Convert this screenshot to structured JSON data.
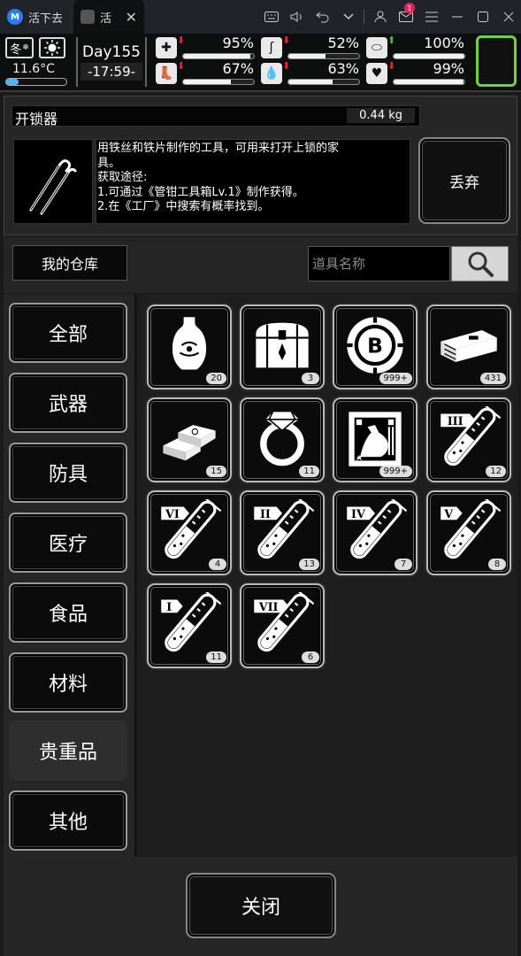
{
  "titlebar": {
    "tabs": [
      {
        "label": "活下去",
        "icon": "app-logo-icon"
      },
      {
        "label": "活",
        "icon": "game-thumb-icon"
      }
    ],
    "mail_badge": "1",
    "icons": [
      "keyboard-icon",
      "volume-icon",
      "undo-icon",
      "chevron-down-icon",
      "user-icon",
      "mail-icon",
      "menu-icon",
      "minimize-icon",
      "maximize-icon",
      "close-icon"
    ]
  },
  "hud": {
    "season": "冬",
    "temperature": "11.6°C",
    "temperature_level": 0.2,
    "day": "Day155",
    "time": "-17:59-",
    "stats": [
      {
        "name": "health",
        "icon": "health-kit-icon",
        "value": "95%",
        "level": 0.95,
        "trend": "down"
      },
      {
        "name": "hunger",
        "icon": "stomach-icon",
        "value": "52%",
        "level": 0.52,
        "trend": "down"
      },
      {
        "name": "medicine",
        "icon": "pill-icon",
        "value": "100%",
        "level": 1.0,
        "trend": "up"
      },
      {
        "name": "stamina",
        "icon": "foot-icon",
        "value": "67%",
        "level": 0.67,
        "trend": "down"
      },
      {
        "name": "thirst",
        "icon": "water-drop-icon",
        "value": "63%",
        "level": 0.63,
        "trend": "down"
      },
      {
        "name": "mood",
        "icon": "heart-icon",
        "value": "99%",
        "level": 0.99,
        "trend": "down"
      }
    ],
    "accent": "#6fd13c"
  },
  "detail": {
    "name": "开锁器",
    "weight": "0.44 kg",
    "description_lines": [
      "用铁丝和铁片制作的工具，可用来打开上锁的家",
      "具。",
      "获取途径:",
      "1.可通过《管钳工具箱Lv.1》制作获得。",
      "2.在《工厂》中搜索有概率找到。"
    ],
    "discard_label": "丢弃"
  },
  "warehouse": {
    "title": "我的仓库",
    "search_placeholder": "道具名称"
  },
  "categories": [
    "全部",
    "武器",
    "防具",
    "医疗",
    "食品",
    "材料",
    "贵重品",
    "其他"
  ],
  "active_category": "贵重品",
  "items": [
    {
      "icon": "vase-icon",
      "qty": "20"
    },
    {
      "icon": "treasure-chest-icon",
      "qty": "3"
    },
    {
      "icon": "bitcoin-chip-icon",
      "qty": "999+"
    },
    {
      "icon": "cash-bundle-icon",
      "qty": "431"
    },
    {
      "icon": "gold-bars-icon",
      "qty": "15"
    },
    {
      "icon": "diamond-ring-icon",
      "qty": "11"
    },
    {
      "icon": "stamp-card-icon",
      "qty": "999+"
    },
    {
      "icon": "test-tube-iii-icon",
      "qty": "12"
    },
    {
      "icon": "test-tube-vi-icon",
      "qty": "4"
    },
    {
      "icon": "test-tube-ii-icon",
      "qty": "13"
    },
    {
      "icon": "test-tube-iv-icon",
      "qty": "7"
    },
    {
      "icon": "test-tube-v-icon",
      "qty": "8"
    },
    {
      "icon": "test-tube-i-icon",
      "qty": "11"
    },
    {
      "icon": "test-tube-vii-icon",
      "qty": "6"
    }
  ],
  "tube_numerals": {
    "test-tube-iii-icon": "III",
    "test-tube-vi-icon": "VI",
    "test-tube-ii-icon": "II",
    "test-tube-iv-icon": "IV",
    "test-tube-v-icon": "V",
    "test-tube-i-icon": "I",
    "test-tube-vii-icon": "VII"
  },
  "footer": {
    "close_label": "关闭"
  }
}
